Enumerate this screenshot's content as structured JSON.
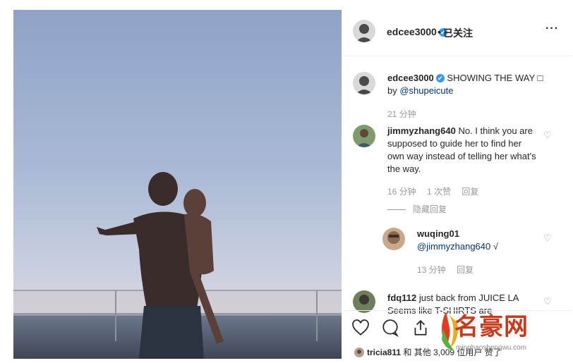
{
  "header": {
    "username": "edcee3000",
    "verified": "✔",
    "separator": "•",
    "follow_label": "已关注",
    "more_label": "···"
  },
  "caption": {
    "username": "edcee3000",
    "verified": "✔",
    "text": "SHOWING THE WAY □",
    "by": "by",
    "mention": "@shupeicute",
    "time": "21 分钟"
  },
  "comments": [
    {
      "username": "jimmyzhang640",
      "text": "No. I think you are supposed to guide her to find her own way instead of telling her what's the way.",
      "time": "16 分钟",
      "likes": "1 次赞",
      "reply_label": "回复",
      "hide_replies_label": "隐藏回复"
    },
    {
      "username": "wuqing01",
      "mention": "@jimmyzhang640",
      "text": "√",
      "time": "13 分钟",
      "reply_label": "回复"
    },
    {
      "username": "fdq112",
      "text": "just back from JUICE LA Seems like T-SHIRTS are"
    }
  ],
  "likes": {
    "user": "tricia811",
    "text": "和 其他 3,009 位用户 赞了"
  },
  "icons": {
    "heart": "heart-outline-icon",
    "comment": "comment-icon",
    "share": "share-icon",
    "save": "bookmark-icon",
    "more": "more-horizontal-icon"
  },
  "watermark": {
    "text": "名豪网",
    "url": "minghaoshengwu.com"
  },
  "colors": {
    "verified": "#3897f0",
    "mention": "#003569",
    "meta": "#999999",
    "watermark": "#c73a1b"
  }
}
